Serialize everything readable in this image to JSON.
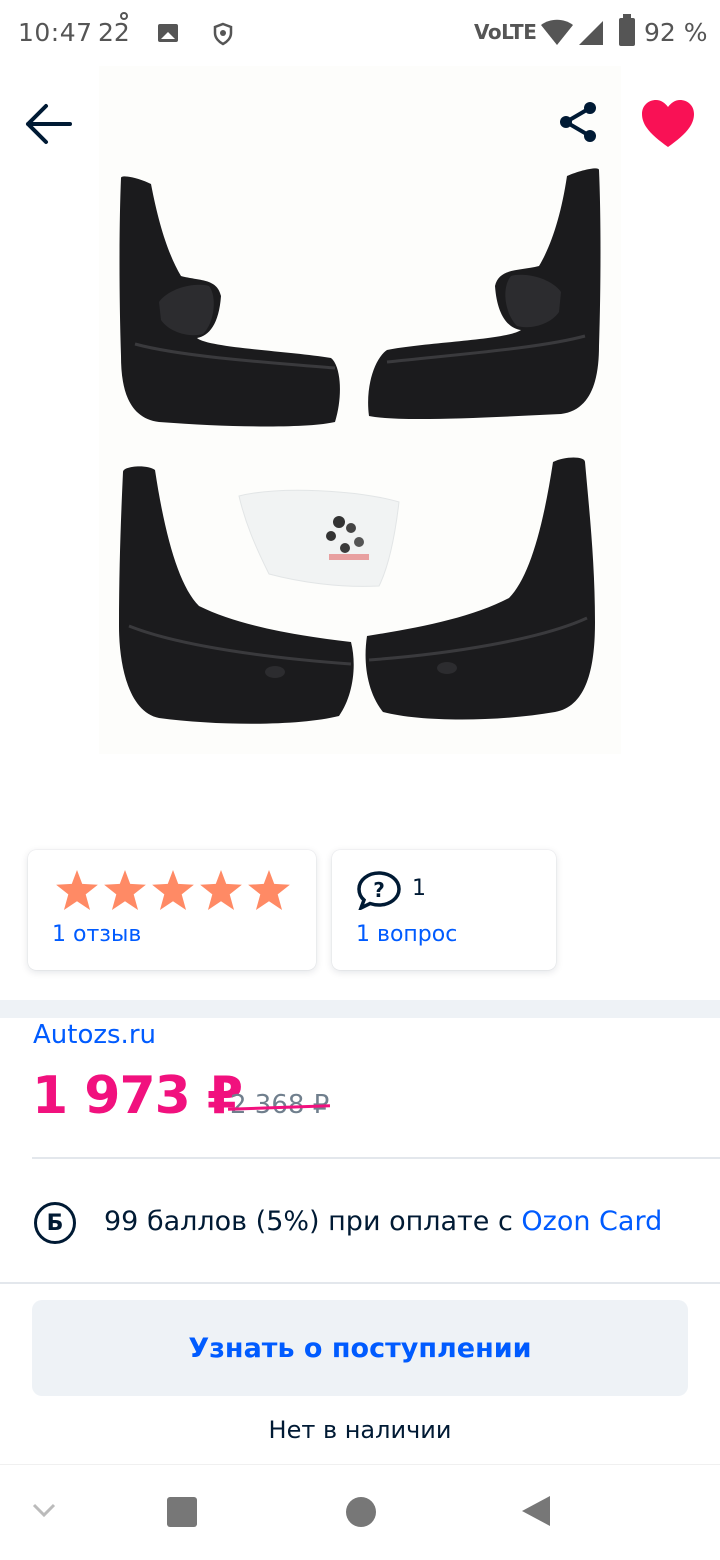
{
  "status_bar": {
    "time": "10:47",
    "temperature": "22",
    "network": "VoLTE",
    "battery": "92 %"
  },
  "product": {
    "image_alt": "product-image"
  },
  "rating": {
    "stars": 5,
    "reviews_label": "1 отзыв"
  },
  "questions": {
    "count": "1",
    "label": "1 вопрос"
  },
  "seller": "Autozs.ru",
  "price": {
    "current": "1 973 ₽",
    "old": "2 368 ₽"
  },
  "bonus": {
    "icon_letter": "Б",
    "text": "99 баллов (5%) при оплате с ",
    "link": "Ozon Card"
  },
  "notify_button": "Узнать о поступлении",
  "stock_status": "Нет в наличии",
  "colors": {
    "accent_blue": "#005bff",
    "price_pink": "#f1117e",
    "star_orange": "#ff8a65",
    "heart_red": "#f91155"
  }
}
